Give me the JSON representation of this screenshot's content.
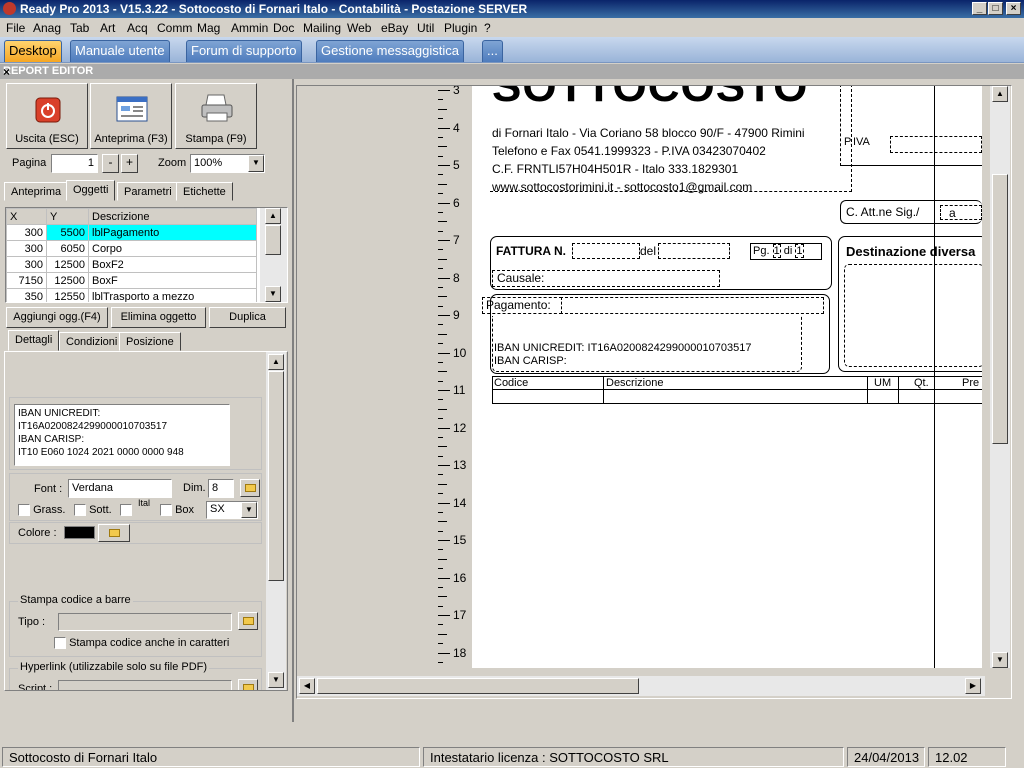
{
  "window": {
    "title": "Ready Pro 2013 - V15.3.22 - Sottocosto di Fornari Italo - Contabilità - Postazione SERVER",
    "min": "_",
    "max": "□",
    "close": "×"
  },
  "menu": [
    "File",
    "Anag",
    "Tab",
    "Art",
    "Acq",
    "Comm",
    "Mag",
    "Ammin",
    "Doc",
    "Mailing",
    "Web",
    "eBay",
    "Util",
    "Plugin",
    "?"
  ],
  "desktop_tabs": [
    "Desktop",
    "Manuale utente",
    "Forum di supporto",
    "Gestione messaggistica",
    "..."
  ],
  "report_editor": {
    "title": "REPORT EDITOR",
    "close": "×"
  },
  "toolbar": {
    "exit": "Uscita (ESC)",
    "preview": "Anteprima (F3)",
    "print": "Stampa (F9)"
  },
  "paging": {
    "page_label": "Pagina",
    "page_value": "1",
    "minus": "-",
    "plus": "+",
    "zoom_label": "Zoom",
    "zoom_value": "100%"
  },
  "upper_tabs": [
    "Anteprima",
    "Oggetti",
    "Parametri",
    "Etichette"
  ],
  "objects_table": {
    "headers": [
      "X",
      "Y",
      "Descrizione"
    ],
    "rows": [
      [
        "300",
        "5500",
        "lblPagamento"
      ],
      [
        "300",
        "6050",
        "Corpo"
      ],
      [
        "300",
        "12500",
        "BoxF2"
      ],
      [
        "7150",
        "12500",
        "BoxF"
      ],
      [
        "350",
        "12550",
        "lblTrasporto a mezzo"
      ]
    ]
  },
  "object_buttons": {
    "add": "Aggiungi ogg.(F4)",
    "delete": "Elimina oggetto",
    "duplicate": "Duplica"
  },
  "lower_tabs": [
    "Dettagli",
    "Condizioni",
    "Posizione"
  ],
  "details": {
    "text_lines": [
      "IBAN UNICREDIT:",
      "IT16A0200824299000010703517",
      "IBAN CARISP:",
      "IT10 E060 1024 2021 0000 0000 948"
    ],
    "font_label": "Font :",
    "font_value": "Verdana",
    "dim_label": "Dim.",
    "dim_value": "8",
    "bold": "Grass.",
    "underline": "Sott.",
    "italic": "Ital",
    "box": "Box",
    "align_value": "SX",
    "color_label": "Colore :",
    "color_value": "#000000",
    "barcode_group": "Stampa codice a barre",
    "barcode_type_label": "Tipo :",
    "barcode_chars": "Stampa codice anche in caratteri",
    "hyperlink_group": "Hyperlink (utilizzabile solo su file PDF)",
    "script_label": "Script :"
  },
  "document": {
    "logo": "SOTTOCOSTO",
    "header_lines": [
      "di Fornari Italo - Via Coriano 58 blocco 90/F - 47900 Rimini",
      "Telefono e Fax 0541.1999323 - P.IVA 03423070402",
      "C.F. FRNTLI57H04H501R - Italo 333.1829301",
      "www.sottocostorimini.it - sottocosto1@gmail.com"
    ],
    "piva": "P.IVA",
    "att": "C. Att.ne Sig./",
    "att_a": "a",
    "fattura": "FATTURA N.",
    "del": "del",
    "pg": "Pg.",
    "pg_num": "1",
    "di": "di",
    "pg_tot": "1",
    "causale": "Causale:",
    "destinazione": "Destinazione diversa",
    "pagamento": "Pagamento:",
    "iban1": "IBAN UNICREDIT: IT16A0200824299000010703517",
    "iban2": "IBAN CARISP:",
    "columns": [
      "Codice",
      "Descrizione",
      "UM",
      "Qt.",
      "Pre"
    ]
  },
  "ruler": [
    "3",
    "4",
    "5",
    "6",
    "7",
    "8",
    "9",
    "10",
    "11",
    "12",
    "13",
    "14",
    "15",
    "16",
    "17",
    "18"
  ],
  "status": {
    "company": "Sottocosto di Fornari Italo",
    "license": "Intestatario licenza : SOTTOCOSTO SRL",
    "date": "24/04/2013",
    "time": "12.02"
  }
}
